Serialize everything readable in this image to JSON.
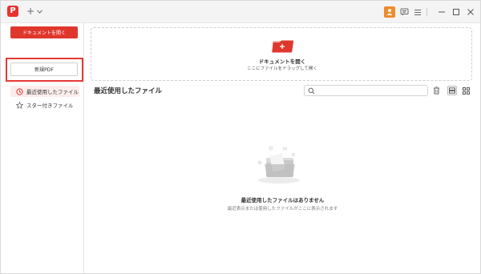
{
  "app": {
    "logo_letter": "P"
  },
  "titlebar": {
    "new_tab": "+"
  },
  "sidebar": {
    "open_document_label": "ドキュメントを開く",
    "new_pdf_label": "新規PDF",
    "nav": [
      {
        "label": "最近使用したファイル",
        "icon": "clock-icon"
      },
      {
        "label": "スター付きファイル",
        "icon": "star-icon"
      }
    ]
  },
  "dropzone": {
    "title": "ドキュメントを開く",
    "subtitle": "ここにファイルをドラッグして開く"
  },
  "recent": {
    "title": "最近使用したファイル",
    "search_placeholder": ""
  },
  "empty": {
    "title": "最近使用したファイルはありません",
    "subtitle": "最近表示または使用したファイルがここに表示されます"
  },
  "colors": {
    "accent": "#e0372c",
    "highlight": "#e53935",
    "user": "#f08a2a"
  }
}
